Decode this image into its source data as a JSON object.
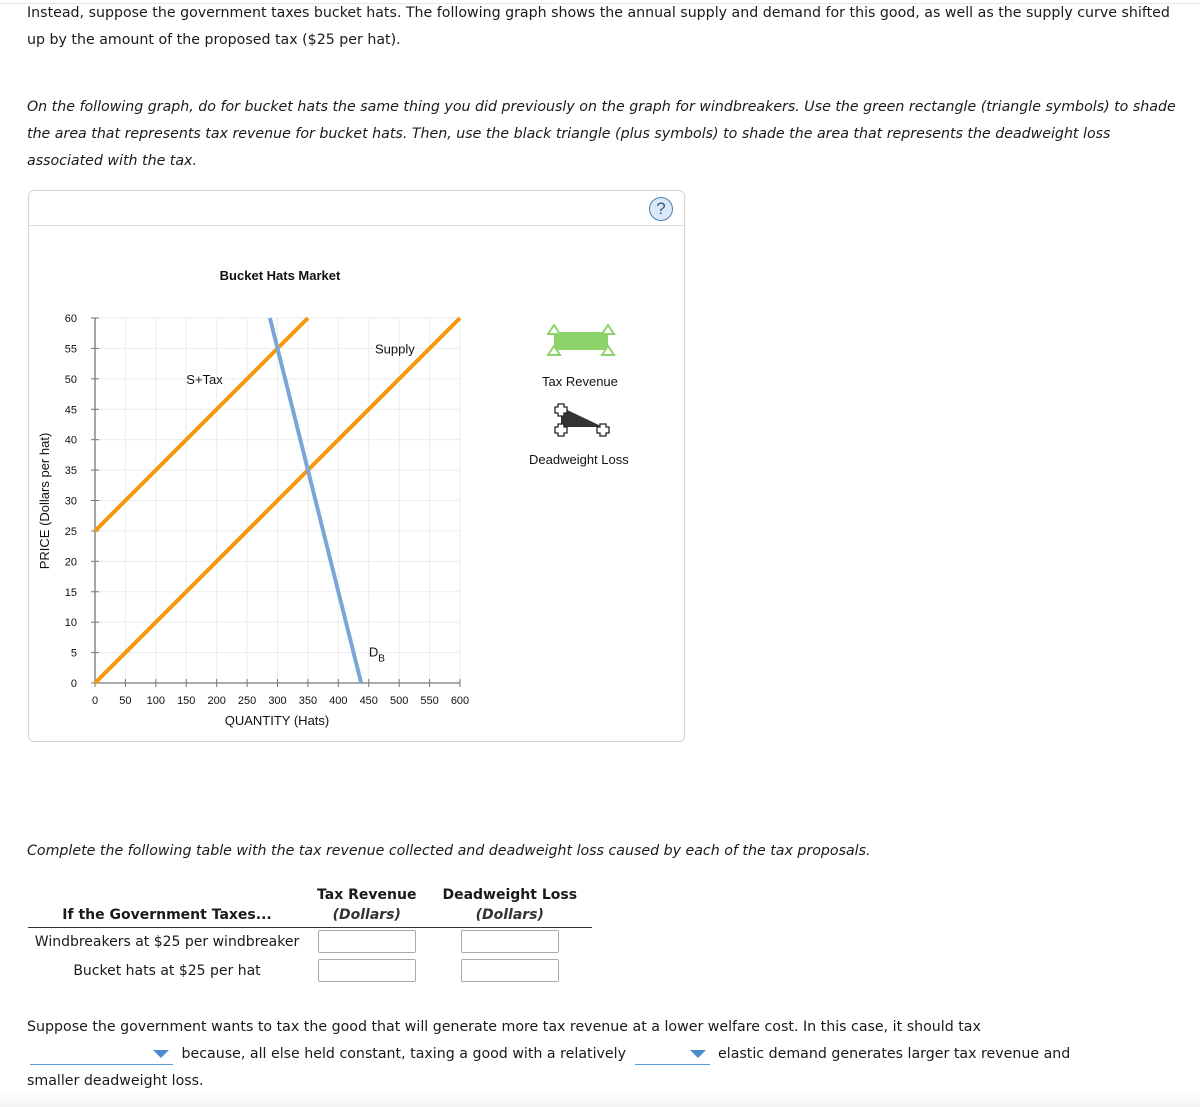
{
  "intro": {
    "paragraph1": "Instead, suppose the government taxes bucket hats. The following graph shows the annual supply and demand for this good, as well as the supply curve shifted up by the amount of the proposed tax ($25 per hat).",
    "paragraph2": "On the following graph, do for bucket hats the same thing you did previously on the graph for windbreakers. Use the green rectangle (triangle symbols) to shade the area that represents tax revenue for bucket hats. Then, use the black triangle (plus symbols) to shade the area that represents the deadweight loss associated with the tax."
  },
  "graph_tool": {
    "help_icon": "question-mark-icon",
    "help_label": "?",
    "legend": [
      {
        "tool": "tax-revenue-rectangle",
        "label": "Tax Revenue",
        "color": "#8cd36a",
        "marker": "triangle"
      },
      {
        "tool": "deadweight-loss-triangle",
        "label": "Deadweight Loss",
        "color": "#333333",
        "marker": "plus"
      }
    ]
  },
  "chart_data": {
    "type": "line",
    "title": "Bucket Hats Market",
    "xlabel": "QUANTITY (Hats)",
    "ylabel": "PRICE (Dollars per hat)",
    "xlim": [
      0,
      600
    ],
    "ylim": [
      0,
      60
    ],
    "xticks": [
      0,
      50,
      100,
      150,
      200,
      250,
      300,
      350,
      400,
      450,
      500,
      550,
      600
    ],
    "yticks": [
      0,
      5,
      10,
      15,
      20,
      25,
      30,
      35,
      40,
      45,
      50,
      55,
      60
    ],
    "grid": true,
    "series": [
      {
        "name": "Supply",
        "label": "Supply",
        "color": "#f7960f",
        "points": [
          [
            0,
            0
          ],
          [
            600,
            60
          ]
        ]
      },
      {
        "name": "S+Tax",
        "label": "S+Tax",
        "color": "#f7960f",
        "points": [
          [
            0,
            25
          ],
          [
            350,
            60
          ]
        ]
      },
      {
        "name": "Demand",
        "label": "D",
        "label_sub": "B",
        "color": "#7ba7d6",
        "points": [
          [
            287.5,
            60
          ],
          [
            437.5,
            0
          ]
        ]
      }
    ],
    "annotations": [
      {
        "text": "S+Tax",
        "x": 155,
        "y": 50
      },
      {
        "text": "Supply",
        "x": 480,
        "y": 55
      },
      {
        "text": "DB",
        "x": 460,
        "y": 5
      }
    ]
  },
  "table": {
    "instruction": "Complete the following table with the tax revenue collected and deadweight loss caused by each of the tax proposals.",
    "col_headers": [
      {
        "top": "",
        "sub": "If the Government Taxes..."
      },
      {
        "top": "Tax Revenue",
        "sub": "(Dollars)"
      },
      {
        "top": "Deadweight Loss",
        "sub": "(Dollars)"
      }
    ],
    "rows": [
      {
        "label": "Windbreakers at $25 per windbreaker",
        "tax_revenue": "",
        "deadweight_loss": ""
      },
      {
        "label": "Bucket hats at $25 per hat",
        "tax_revenue": "",
        "deadweight_loss": ""
      }
    ]
  },
  "conclusion": {
    "text1": "Suppose the government wants to tax the good that will generate more tax revenue at a lower welfare cost. In this case, it should tax",
    "dropdown1_value": "",
    "text2": "because, all else held constant, taxing a good with a relatively",
    "dropdown2_value": "",
    "text3": "elastic demand generates larger tax revenue and",
    "text4": "smaller deadweight loss."
  }
}
